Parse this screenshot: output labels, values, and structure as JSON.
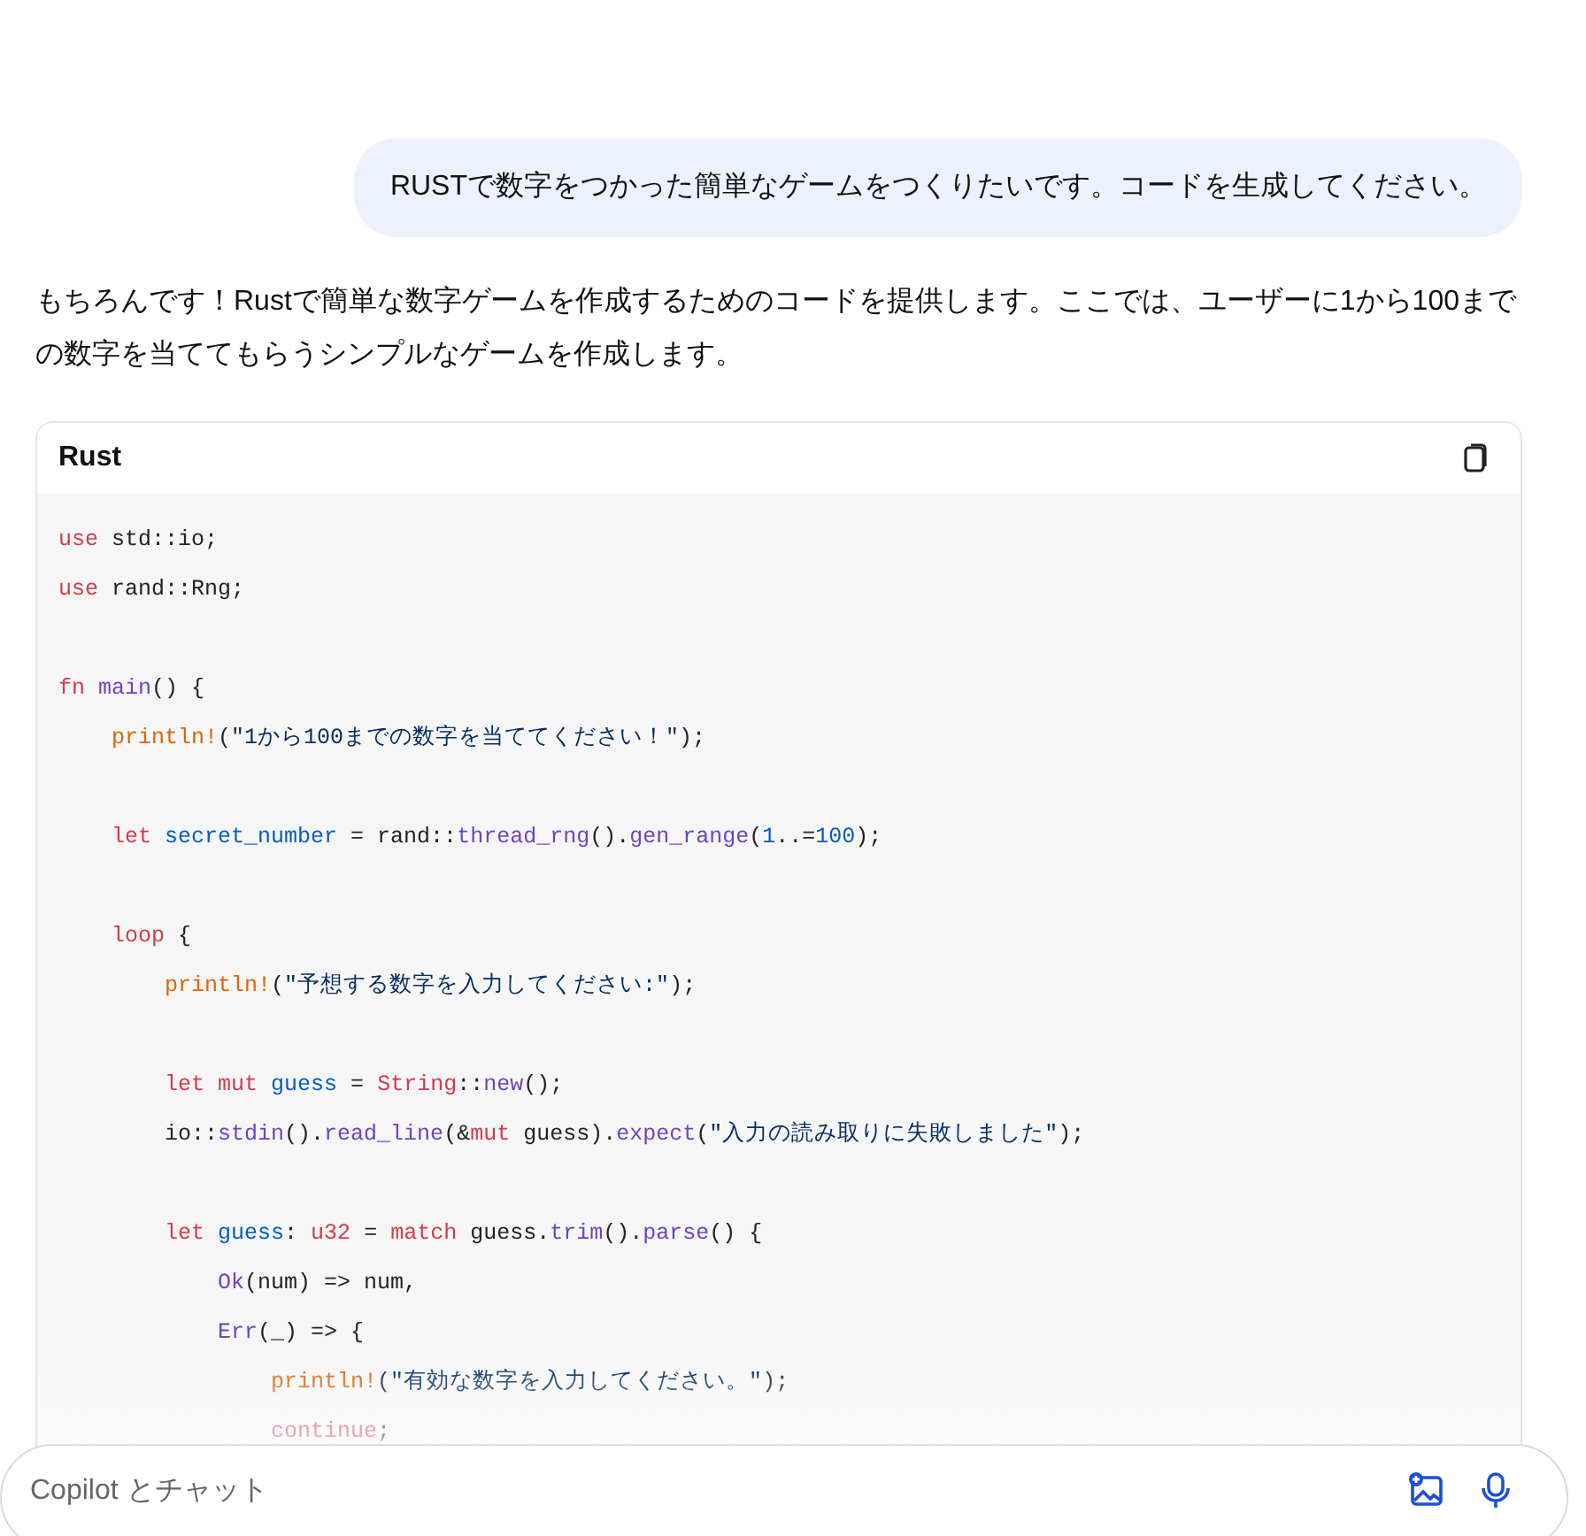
{
  "user_message": "RUSTで数字をつかった簡単なゲームをつくりたいです。コードを生成してください。",
  "assistant_message": "もちろんです！Rustで簡単な数字ゲームを作成するためのコードを提供します。ここでは、ユーザーに1から100までの数字を当ててもらうシンプルなゲームを作成します。",
  "code_block": {
    "language": "Rust",
    "lines": [
      {
        "kind": "code",
        "tokens": [
          {
            "text": "use",
            "kind": "kw"
          },
          {
            "text": " std::io;",
            "kind": "plain"
          }
        ]
      },
      {
        "kind": "code",
        "tokens": [
          {
            "text": "use",
            "kind": "kw"
          },
          {
            "text": " rand::Rng;",
            "kind": "plain"
          }
        ]
      },
      {
        "kind": "blank"
      },
      {
        "kind": "code",
        "tokens": [
          {
            "text": "fn ",
            "kind": "kw"
          },
          {
            "text": "main",
            "kind": "fn"
          },
          {
            "text": "() {",
            "kind": "plain"
          }
        ]
      },
      {
        "kind": "code",
        "tokens": [
          {
            "text": "    println!",
            "kind": "mac"
          },
          {
            "text": "(",
            "kind": "plain"
          },
          {
            "text": "\"1から100までの数字を当ててください！\"",
            "kind": "str"
          },
          {
            "text": ");",
            "kind": "plain"
          }
        ]
      },
      {
        "kind": "blank"
      },
      {
        "kind": "code",
        "tokens": [
          {
            "text": "    let ",
            "kind": "kw"
          },
          {
            "text": "secret_number",
            "kind": "var"
          },
          {
            "text": " = rand::",
            "kind": "plain"
          },
          {
            "text": "thread_rng",
            "kind": "fn"
          },
          {
            "text": "().",
            "kind": "plain"
          },
          {
            "text": "gen_range",
            "kind": "fn"
          },
          {
            "text": "(",
            "kind": "plain"
          },
          {
            "text": "1",
            "kind": "num"
          },
          {
            "text": "..=",
            "kind": "plain"
          },
          {
            "text": "100",
            "kind": "num"
          },
          {
            "text": ");",
            "kind": "plain"
          }
        ]
      },
      {
        "kind": "blank"
      },
      {
        "kind": "code",
        "tokens": [
          {
            "text": "    loop",
            "kind": "kw"
          },
          {
            "text": " {",
            "kind": "plain"
          }
        ]
      },
      {
        "kind": "code",
        "tokens": [
          {
            "text": "        println!",
            "kind": "mac"
          },
          {
            "text": "(",
            "kind": "plain"
          },
          {
            "text": "\"予想する数字を入力してください:\"",
            "kind": "str"
          },
          {
            "text": ");",
            "kind": "plain"
          }
        ]
      },
      {
        "kind": "blank"
      },
      {
        "kind": "code",
        "tokens": [
          {
            "text": "        let mut ",
            "kind": "kw"
          },
          {
            "text": "guess",
            "kind": "var"
          },
          {
            "text": " = ",
            "kind": "plain"
          },
          {
            "text": "String",
            "kind": "kw"
          },
          {
            "text": "::",
            "kind": "plain"
          },
          {
            "text": "new",
            "kind": "fn"
          },
          {
            "text": "();",
            "kind": "plain"
          }
        ]
      },
      {
        "kind": "code",
        "tokens": [
          {
            "text": "        io::",
            "kind": "plain"
          },
          {
            "text": "stdin",
            "kind": "fn"
          },
          {
            "text": "().",
            "kind": "plain"
          },
          {
            "text": "read_line",
            "kind": "fn"
          },
          {
            "text": "(&",
            "kind": "plain"
          },
          {
            "text": "mut",
            "kind": "kw"
          },
          {
            "text": " guess).",
            "kind": "plain"
          },
          {
            "text": "expect",
            "kind": "fn"
          },
          {
            "text": "(",
            "kind": "plain"
          },
          {
            "text": "\"入力の読み取りに失敗しました\"",
            "kind": "str"
          },
          {
            "text": ");",
            "kind": "plain"
          }
        ]
      },
      {
        "kind": "blank"
      },
      {
        "kind": "code",
        "tokens": [
          {
            "text": "        let ",
            "kind": "kw"
          },
          {
            "text": "guess",
            "kind": "var"
          },
          {
            "text": ": ",
            "kind": "plain"
          },
          {
            "text": "u32",
            "kind": "kw"
          },
          {
            "text": " = ",
            "kind": "plain"
          },
          {
            "text": "match",
            "kind": "kw"
          },
          {
            "text": " guess.",
            "kind": "plain"
          },
          {
            "text": "trim",
            "kind": "fn"
          },
          {
            "text": "().",
            "kind": "plain"
          },
          {
            "text": "parse",
            "kind": "fn"
          },
          {
            "text": "() {",
            "kind": "plain"
          }
        ]
      },
      {
        "kind": "code",
        "tokens": [
          {
            "text": "            Ok",
            "kind": "fn"
          },
          {
            "text": "(num) => num,",
            "kind": "plain"
          }
        ]
      },
      {
        "kind": "code",
        "tokens": [
          {
            "text": "            Err",
            "kind": "fn"
          },
          {
            "text": "(_) => {",
            "kind": "plain"
          }
        ]
      },
      {
        "kind": "code",
        "tokens": [
          {
            "text": "                println!",
            "kind": "mac"
          },
          {
            "text": "(",
            "kind": "plain"
          },
          {
            "text": "\"有効な数字を入力してください。\"",
            "kind": "str"
          },
          {
            "text": ");",
            "kind": "plain"
          }
        ]
      },
      {
        "kind": "code",
        "tokens": [
          {
            "text": "                continue",
            "kind": "kw"
          },
          {
            "text": ";",
            "kind": "plain"
          }
        ]
      }
    ]
  },
  "chat_input": {
    "placeholder": "Copilot とチャット"
  }
}
